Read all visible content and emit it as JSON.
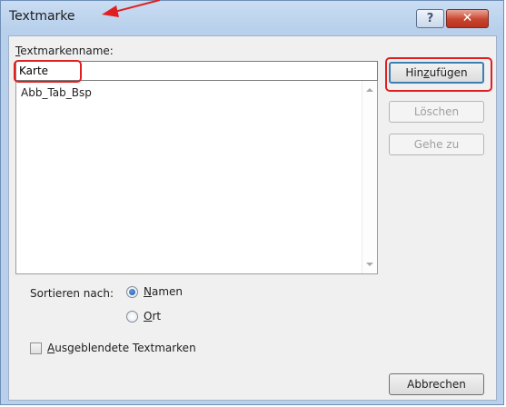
{
  "window": {
    "title": "Textmarke",
    "help_glyph": "?",
    "close_glyph": "✕"
  },
  "form": {
    "name_label": "extmarkenname:",
    "name_label_accel": "T",
    "name_value": "Karte",
    "list_items": [
      "Abb_Tab_Bsp"
    ]
  },
  "buttons": {
    "add": {
      "pre": "Hin",
      "accel": "z",
      "post": "ufügen"
    },
    "delete": "Löschen",
    "goto": "Gehe zu",
    "cancel": "Abbrechen"
  },
  "sort": {
    "label": "Sortieren nach:",
    "option_name": {
      "accel": "N",
      "rest": "amen",
      "selected": true
    },
    "option_place": {
      "accel": "O",
      "rest": "rt",
      "selected": false
    }
  },
  "hidden_bookmarks": {
    "accel": "A",
    "rest": "usgeblendete Textmarken",
    "checked": false
  },
  "colors": {
    "annotation_red": "#e02020",
    "title_bar": "#b8d0ec",
    "dialog_bg": "#f0f0f0",
    "radio_selected": "#1d58a8"
  }
}
